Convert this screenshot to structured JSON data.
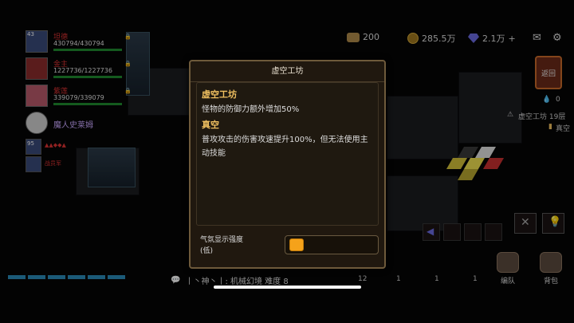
{
  "party": {
    "members": [
      {
        "level": "43",
        "name": "坦德",
        "hp": "430794/430794"
      },
      {
        "level": "",
        "name": "金主",
        "hp": "1227736/1227736"
      },
      {
        "level": "",
        "name": "紫莲",
        "hp": "339079/339079"
      },
      {
        "level": "",
        "name": "魔人史莱姆",
        "hp": ""
      }
    ],
    "mini_rows": [
      {
        "level": "95"
      },
      {
        "level": "",
        "name": "战员军"
      }
    ]
  },
  "resources": {
    "stamina": "200",
    "gold": "285.5万",
    "gems": "2.1万",
    "plus": "+"
  },
  "side": {
    "back_label": "返回",
    "drop_count": "0",
    "floor_info": "虚空工坊 19层",
    "mode": "真空"
  },
  "modal": {
    "title": "虚空工坊",
    "sections": [
      {
        "title": "虚空工坊",
        "desc": "怪物的防御力额外增加50%"
      },
      {
        "title": "真空",
        "desc": "普攻攻击的伤害攻速提升100%，但无法使用主动技能"
      }
    ],
    "strength_label": "气氛显示强度",
    "strength_value": "(低)",
    "strength_level": 0.1
  },
  "bottom": {
    "chat_text": "丨丶神丶丨: 机械幻境  难度 8",
    "items": [
      {
        "count": "12"
      },
      {
        "count": "1"
      },
      {
        "count": "1"
      },
      {
        "count": "1"
      }
    ],
    "team_label": "编队",
    "bag_label": "背包"
  }
}
